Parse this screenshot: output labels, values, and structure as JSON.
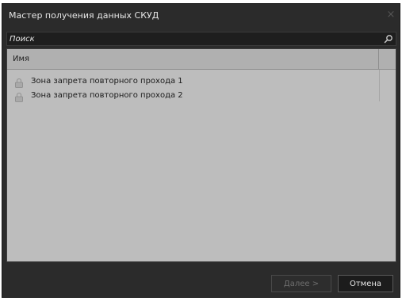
{
  "window": {
    "title": "Мастер получения данных СКУД",
    "close_glyph": "×"
  },
  "search": {
    "placeholder": "Поиск",
    "value": ""
  },
  "list": {
    "column_header": "Имя",
    "items": [
      {
        "icon": "lock-icon",
        "label": "Зона запрета повторного прохода 1"
      },
      {
        "icon": "lock-icon",
        "label": "Зона запрета повторного прохода 2"
      }
    ]
  },
  "buttons": {
    "next_label": "Далее >",
    "cancel_label": "Отмена"
  },
  "colors": {
    "window_bg": "#2b2b2b",
    "list_bg": "#bdbdbd",
    "header_bg": "#b0b0b0"
  }
}
